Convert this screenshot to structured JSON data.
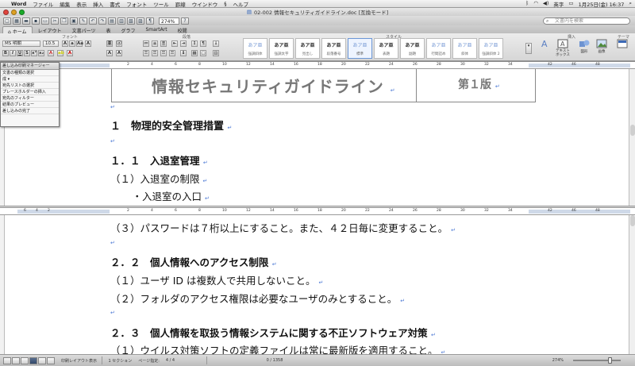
{
  "menubar": {
    "app": "Word",
    "items": [
      "ファイル",
      "編集",
      "表示",
      "挿入",
      "書式",
      "フォント",
      "ツール",
      "罫線",
      "ウインドウ",
      "ヘルプ"
    ],
    "input_mode": "英字",
    "clock": "1月25日(金)  16:37"
  },
  "window": {
    "title": "02-002 情報セキュリティガイドライン.doc [互換モード]"
  },
  "toolbar": {
    "zoom": "274%",
    "search_placeholder": "文書内を検索"
  },
  "ribbon": {
    "tabs": [
      "ホーム",
      "レイアウト",
      "文書パーツ",
      "表",
      "グラフ",
      "SmartArt",
      "校閲"
    ],
    "active_tab": 0,
    "group_labels": {
      "font": "フォント",
      "paragraph": "段落",
      "styles": "スタイル",
      "insert": "挿入",
      "themes": "テーマ"
    },
    "font_name": "MS 明朝",
    "font_size": "10.5",
    "format_buttons": [
      "B",
      "I",
      "U"
    ],
    "style_sample": "あア亜",
    "styles": [
      {
        "name": "強調斜体",
        "light": true
      },
      {
        "name": "強調太字",
        "light": false
      },
      {
        "name": "見出し",
        "light": false
      },
      {
        "name": "段落番号",
        "light": false
      },
      {
        "name": "標準",
        "light": true,
        "selected": true
      },
      {
        "name": "表題",
        "light": false
      },
      {
        "name": "副題",
        "light": false
      },
      {
        "name": "行間詰め",
        "light": true
      },
      {
        "name": "斜体",
        "light": true
      },
      {
        "name": "強調斜体 2",
        "light": true
      }
    ],
    "insert_buttons": [
      {
        "label": "テキスト\nボックス"
      },
      {
        "label": "図形"
      },
      {
        "label": "画像"
      }
    ],
    "themes_label": "テーマ"
  },
  "popup": {
    "header": "差し込み印刷マネージャー",
    "items": [
      "文書の種類の選択",
      "成 ▾",
      "宛先リストの選択",
      "プレースホルダーの挿入",
      "宛先のフィルター",
      "結果のプレビュー",
      "差し込みの完了"
    ]
  },
  "document": {
    "title": "情報セキュリティガイドライン",
    "version": "第１版",
    "pane_top": [
      {
        "text": "１　物理的安全管理措置",
        "style": "h1"
      },
      {
        "text": "",
        "style": "bd"
      },
      {
        "text": "１．１　入退室管理",
        "style": "h2"
      },
      {
        "text": "（１）入退室の制限",
        "style": "bd"
      },
      {
        "text": "　・入退室の入口",
        "style": "bd",
        "indent": true
      }
    ],
    "pane_bottom": [
      {
        "text": "（３）パスワードは７桁以上にすること。また、４２日毎に変更すること。",
        "style": "bd"
      },
      {
        "text": "",
        "style": "bd"
      },
      {
        "text": "２．２　個人情報へのアクセス制限",
        "style": "h2"
      },
      {
        "text": "（１）ユーザ ID は複数人で共用しないこと。",
        "style": "bd"
      },
      {
        "text": "（２）フォルダのアクセス権限は必要なユーザのみとすること。",
        "style": "bd"
      },
      {
        "text": "",
        "style": "bd"
      },
      {
        "text": "２．３　個人情報を取扱う情報システムに関する不正ソフトウェア対策",
        "style": "h2"
      },
      {
        "text": "（１）ウイルス対策ソフトの定義ファイルは常に最新版を適用すること。",
        "style": "bd"
      }
    ],
    "pilcrow": "↵"
  },
  "statusbar": {
    "view": "印刷レイアウト表示",
    "section": "1 セクション",
    "page_label": "ページ指定:",
    "pages": "4 / 4",
    "words": "0 / 1358",
    "zoom": "274%"
  },
  "colors": {
    "pilcrow": "#4c79d4",
    "ruler_track": "#cfd9e8"
  }
}
